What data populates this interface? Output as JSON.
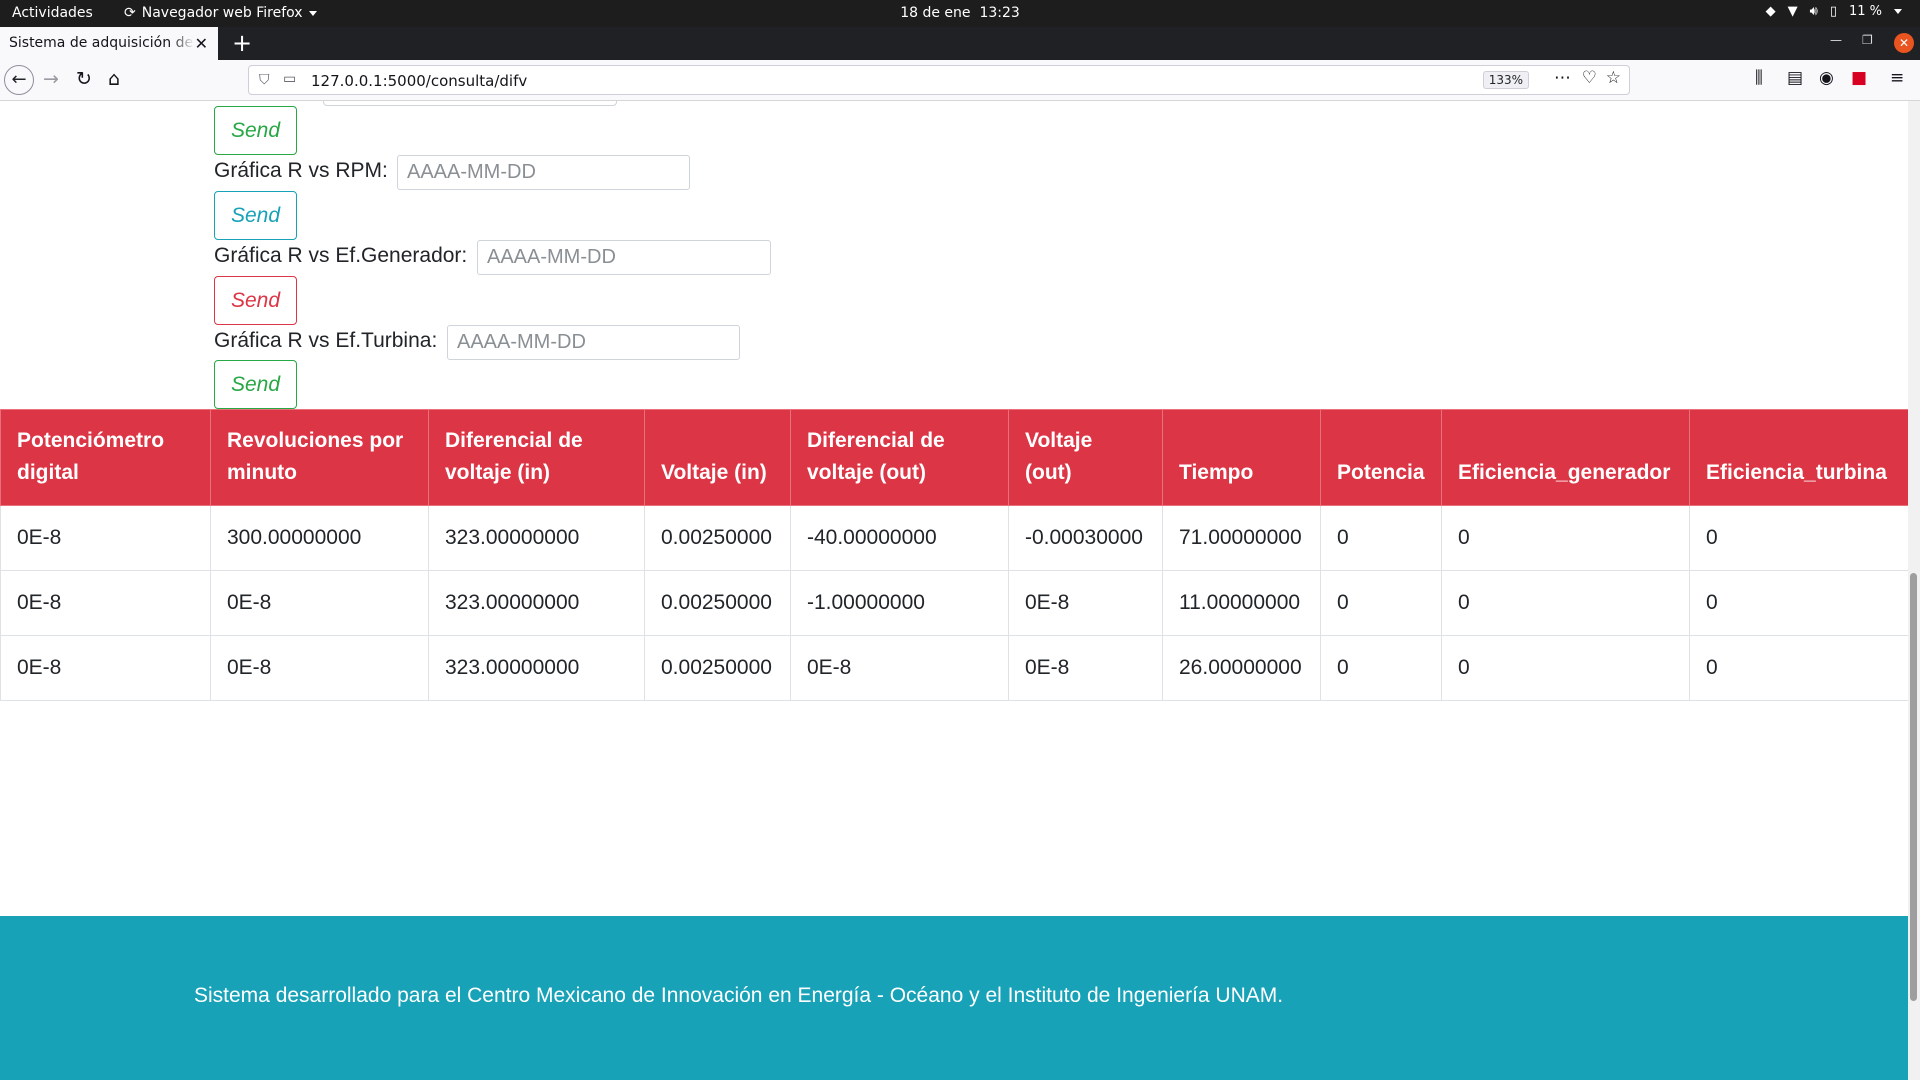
{
  "os_bar": {
    "activities": "Actividades",
    "app_name": "Navegador web Firefox",
    "date": "18 de ene",
    "time": "13:23",
    "battery": "11 %"
  },
  "browser": {
    "tab_title": "Sistema de adquisición de datos",
    "url": "127.0.0.1:5000/consulta/difv",
    "zoom": "133%"
  },
  "form": {
    "placeholder": "AAAA-MM-DD",
    "send_label": "Send",
    "rows": [
      {
        "label": "Gráfica R vs RPM:"
      },
      {
        "label": "Gráfica R vs Ef.Generador:"
      },
      {
        "label": "Gráfica R vs Ef.Turbina:"
      }
    ]
  },
  "table": {
    "headers": [
      [
        "Potenciómetro",
        "digital"
      ],
      [
        "Revoluciones por",
        "minuto"
      ],
      [
        "Diferencial de",
        "voltaje (in)"
      ],
      [
        "",
        "Voltaje (in)"
      ],
      [
        "Diferencial de",
        "voltaje (out)"
      ],
      [
        "Voltaje",
        "(out)"
      ],
      [
        "",
        "Tiempo"
      ],
      [
        "",
        "Potencia"
      ],
      [
        "",
        "Eficiencia_generador"
      ],
      [
        "",
        "Eficiencia_turbina"
      ]
    ],
    "rows": [
      [
        "0E-8",
        "300.00000000",
        "323.00000000",
        "0.00250000",
        "-40.00000000",
        "-0.00030000",
        "71.00000000",
        "0",
        "0",
        "0"
      ],
      [
        "0E-8",
        "0E-8",
        "323.00000000",
        "0.00250000",
        "-1.00000000",
        "0E-8",
        "11.00000000",
        "0",
        "0",
        "0"
      ],
      [
        "0E-8",
        "0E-8",
        "323.00000000",
        "0.00250000",
        "0E-8",
        "0E-8",
        "26.00000000",
        "0",
        "0",
        "0"
      ]
    ]
  },
  "footer": {
    "text": "Sistema desarrollado para el Centro Mexicano de Innovación en Energía - Océano y el Instituto de Ingeniería UNAM."
  },
  "colors": {
    "header_red": "#dc3545",
    "footer_teal": "#17a2b8",
    "send_green": "#28a745",
    "send_cyan": "#17a2b8",
    "send_red": "#dc3545"
  }
}
